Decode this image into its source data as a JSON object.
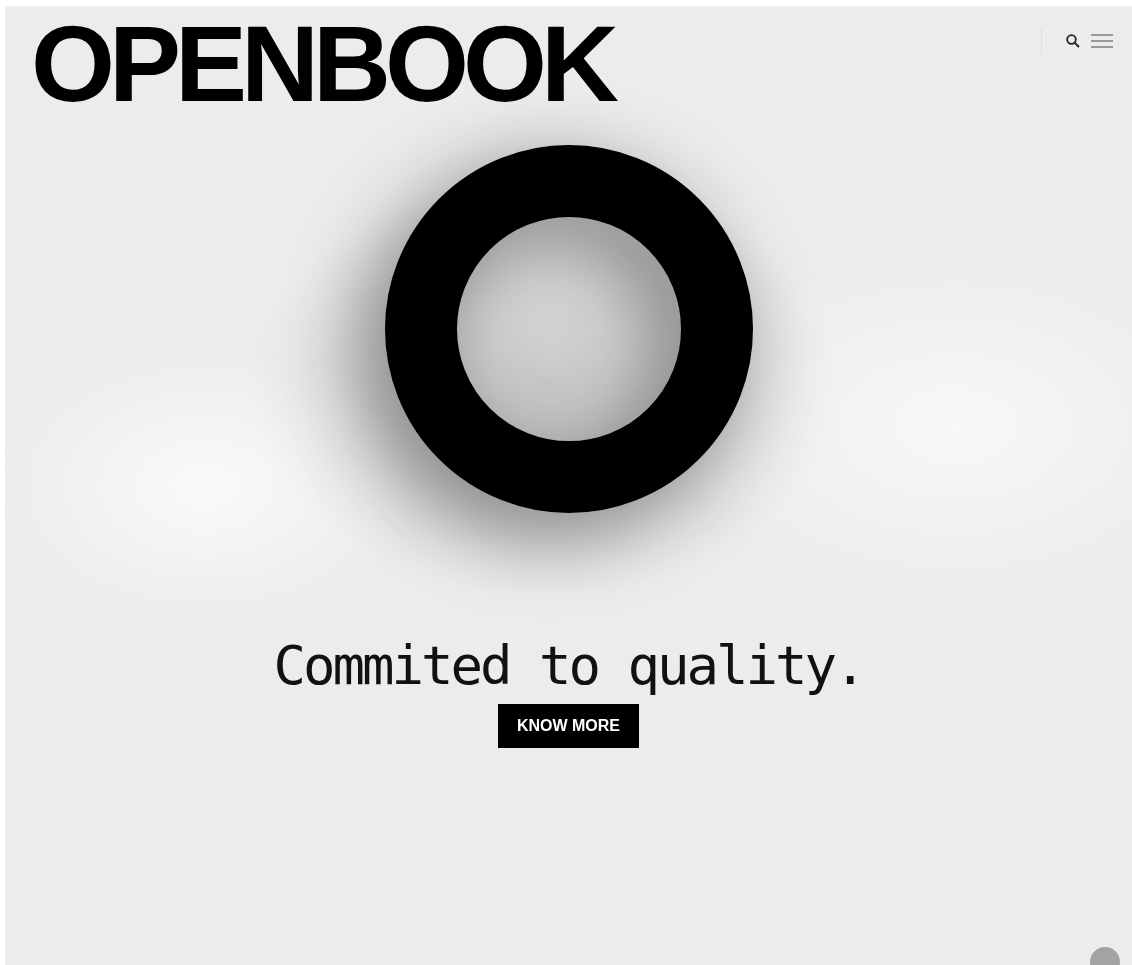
{
  "header": {
    "logo": "OPENBOOK"
  },
  "hero": {
    "headline": "Commited to quality.",
    "button": "KNOW MORE"
  }
}
